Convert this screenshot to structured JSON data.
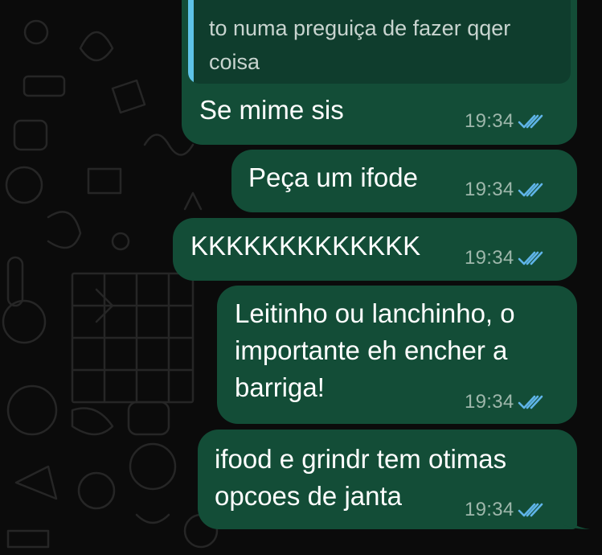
{
  "chat": {
    "colors": {
      "background": "#0b0b0b",
      "outgoing_bubble": "#134d37",
      "quote_background": "#0f3d2d",
      "quote_accent": "#5ec4e8",
      "read_ticks": "#5fb4e8",
      "timestamp": "#9eb7ab"
    },
    "messages": [
      {
        "reply_quote": "to numa preguiça de fazer qqer\ncoisa",
        "text": "Se mime sis",
        "time": "19:34",
        "status_icon": "double-check-read-icon"
      },
      {
        "text": "Peça um ifode",
        "time": "19:34",
        "status_icon": "double-check-read-icon"
      },
      {
        "text": "KKKKKKKKKKKKK",
        "time": "19:34",
        "status_icon": "double-check-read-icon"
      },
      {
        "text": "Leitinho ou lanchinho, o\nimportante eh encher a\nbarriga!",
        "time": "19:34",
        "status_icon": "double-check-read-icon"
      },
      {
        "text": "ifood e grindr tem otimas\nopcoes de janta",
        "time": "19:34",
        "status_icon": "double-check-read-icon"
      }
    ]
  }
}
